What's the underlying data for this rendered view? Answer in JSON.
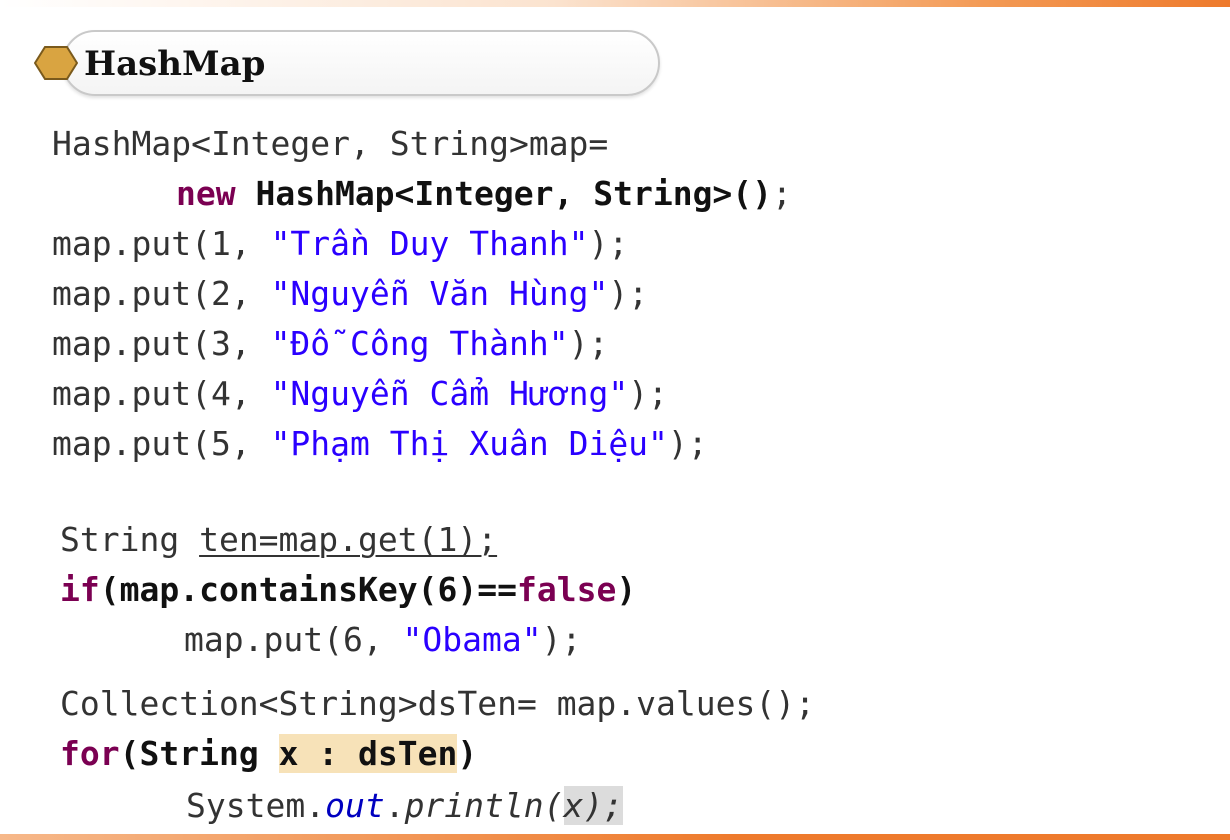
{
  "slide": {
    "title": "HashMap",
    "colors": {
      "accent_orange": "#ee7a2c",
      "hexagon_fill": "#d9a441",
      "keyword": "#7b0052",
      "string": "#2a00ff",
      "highlight": "#f7e2b8"
    }
  },
  "code": {
    "l1": "HashMap<Integer, String>map=",
    "l2_kw": "new",
    "l2_rest": " HashMap<Integer, String>()",
    "l2_end": ";",
    "put_prefix": "map.put(",
    "l3_key": "1, ",
    "l3_val": "\"Trần Duy Thanh\"",
    "l4_key": "2, ",
    "l4_val": "\"Nguyễn Văn Hùng\"",
    "l5_key": "3, ",
    "l5_val": "\"Đỗ Công Thành\"",
    "l6_key": "4, ",
    "l6_val": "\"Nguyễn Cẩm Hương\"",
    "l7_key": "5, ",
    "l7_val": "\"Phạm Thị Xuân Diệu\"",
    "put_suffix": ");",
    "l8_a": "String ",
    "l8_b": "ten=map.get(1);",
    "l9_kw1": "if",
    "l9_mid": "(map.containsKey(6)==",
    "l9_kw2": "false",
    "l9_end": ")",
    "l10_pre": "map.put(6, ",
    "l10_val": "\"Obama\"",
    "l10_end": ");",
    "l11": "Collection<String>dsTen= map.values();",
    "l12_kw": "for",
    "l12_mid": "(String ",
    "l12_hl": "x : dsTen",
    "l12_end": ")",
    "l13_pre": "System.",
    "l13_out": "out",
    "l13_dot": ".",
    "l13_println": "println(",
    "l13_hl": "x);"
  }
}
